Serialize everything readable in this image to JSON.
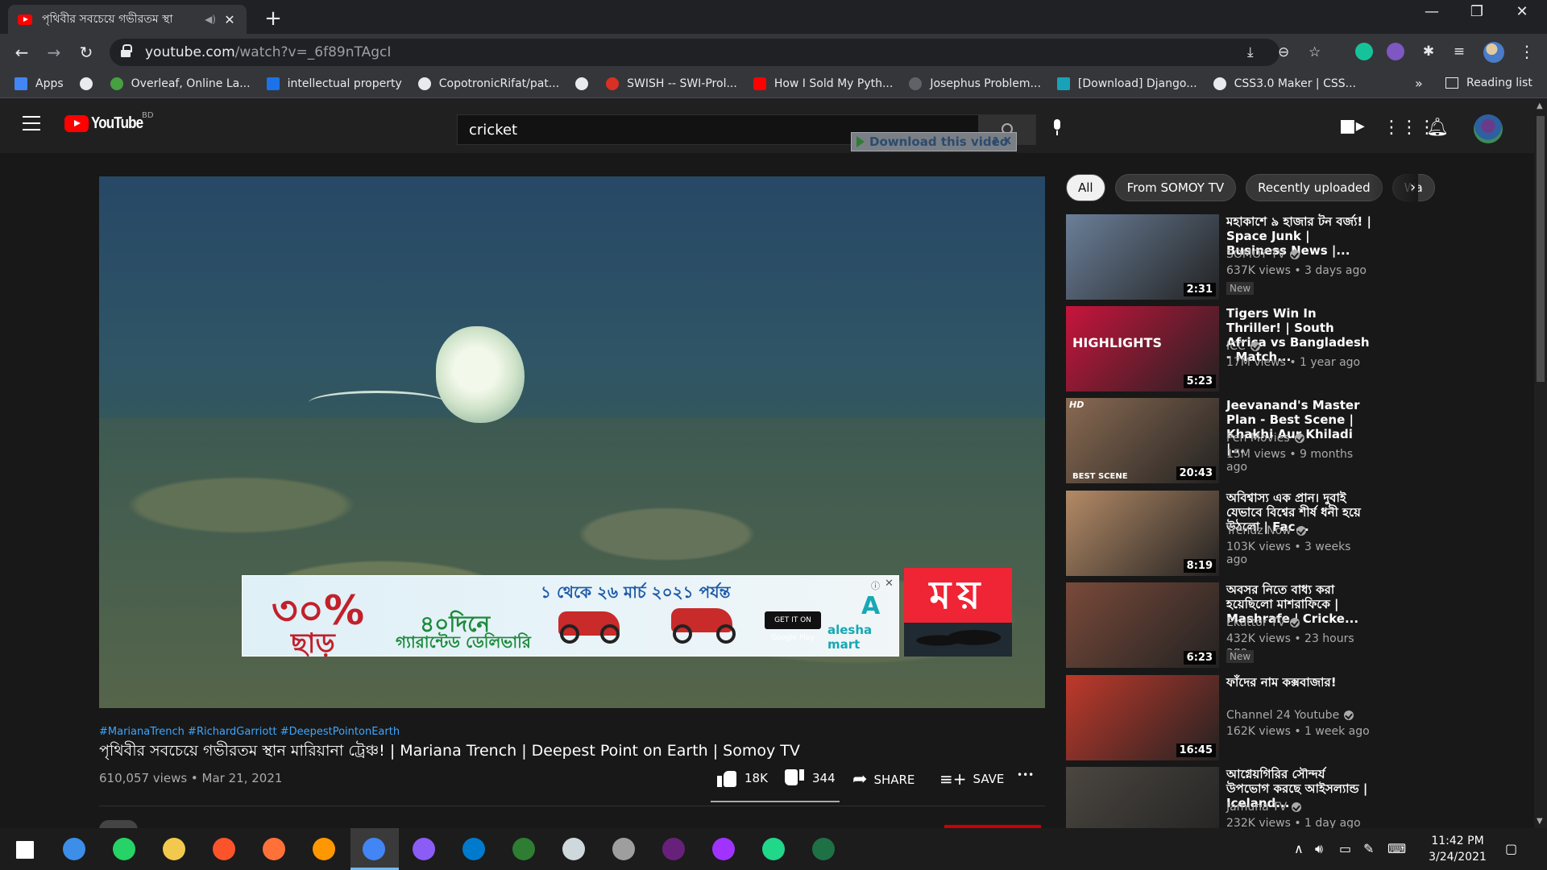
{
  "browser": {
    "tab_title": "পৃথিবীর সবচেয়ে গভীরতম স্থা",
    "url_host": "youtube.com",
    "url_path": "/watch?v=_6f89nTAgcI",
    "window_controls": [
      "—",
      "❐",
      "✕"
    ]
  },
  "bookmarks": [
    {
      "label": "Apps",
      "color": "#4285f4"
    },
    {
      "label": "",
      "color": "#e8eaed"
    },
    {
      "label": "Overleaf, Online La...",
      "color": "#47a141"
    },
    {
      "label": "intellectual property",
      "color": "#1a73e8"
    },
    {
      "label": "CopotronicRifat/pat...",
      "color": "#e8eaed"
    },
    {
      "label": "",
      "color": "#e8eaed"
    },
    {
      "label": "SWISH -- SWI-Prol...",
      "color": "#d93025"
    },
    {
      "label": "How I Sold My Pyth...",
      "color": "#ff0000"
    },
    {
      "label": "Josephus Problem...",
      "color": "#5f6368"
    },
    {
      "label": "[Download] Django...",
      "color": "#17a2b8"
    },
    {
      "label": "CSS3.0 Maker | CSS...",
      "color": "#e8eaed"
    }
  ],
  "bookmarks_more": "»",
  "reading_list": "Reading list",
  "youtube": {
    "logo_text": "YouTube",
    "country_code": "BD",
    "search_query": "cricket",
    "download_bar": "Download this video",
    "download_help": "?",
    "download_close": "X"
  },
  "ad": {
    "discount": "৩০%",
    "discount_word": "ছাড়",
    "date_range": "১ থেকে ২৬ মার্চ ২০২১ পর্যন্ত",
    "days_line": "৪০দিনে",
    "guarantee": "গ্যারান্টেড ডেলিভারি",
    "store_badge": "GET IT ON Google Play",
    "brand": "alesha mart",
    "brand_mark": "A",
    "info": "ⓘ",
    "close": "✕"
  },
  "channel_logo": "ময়",
  "video": {
    "hashtags": "#MarianaTrench #RichardGarriott #DeepestPointonEarth",
    "title": "পৃথিবীর সবচেয়ে গভীরতম স্থান মারিয়ানা ট্রেঞ্চ! | Mariana Trench | Deepest Point on Earth | Somoy TV",
    "meta": "610,057 views • Mar 21, 2021",
    "likes": "18K",
    "dislikes": "344",
    "like_ratio": 0.98,
    "share_label": "SHARE",
    "save_label": "SAVE",
    "more": "•••"
  },
  "chips": [
    "All",
    "From SOMOY TV",
    "Recently uploaded",
    "Wa"
  ],
  "recommendations": [
    {
      "title": "মহাকাশে ৯ হাজার টন বর্জ্য! | Space Junk | Business News |...",
      "channel": "SOMOY TV",
      "views": "637K views • 3 days ago",
      "duration": "2:31",
      "badge": "New",
      "thumb_bg": "#6b7f99"
    },
    {
      "title": "Tigers Win In Thriller! | South Africa vs Bangladesh - Match...",
      "channel": "ICC",
      "views": "17M views • 1 year ago",
      "duration": "5:23",
      "badge": "",
      "thumb_bg": "#c8143c",
      "thumb_text": "HIGHLIGHTS"
    },
    {
      "title": "Jeevanand's Master Plan - Best Scene | Khakhi Aur Khiladi |...",
      "channel": "Pen Movies",
      "views": "15M views • 9 months ago",
      "duration": "20:43",
      "badge": "",
      "thumb_bg": "#8a6a52",
      "thumb_text": "BEST SCENE",
      "thumb_hd": "HD"
    },
    {
      "title": "অবিশ্বাস্য এক প্রান। দুবাই যেভাবে বিশ্বের শীর্ষ ধনী হয়ে উঠলো | Fac...",
      "channel": "Trendz Now",
      "views": "103K views • 3 weeks ago",
      "duration": "8:19",
      "badge": "",
      "thumb_bg": "#b48a66"
    },
    {
      "title": "অবসর নিতে বাধ্য করা হয়েছিলো মাশরাফিকে | Mashrafe | Cricke...",
      "channel": "Ekattor TV",
      "views": "432K views • 23 hours ago",
      "duration": "6:23",
      "badge": "New",
      "thumb_bg": "#7a4a3a"
    },
    {
      "title": "ফাঁদের নাম কক্সবাজার!",
      "channel": "Channel 24 Youtube",
      "views": "162K views • 1 week ago",
      "duration": "16:45",
      "badge": "",
      "thumb_bg": "#c0392b"
    },
    {
      "title": "আগ্নেয়গিরির সৌন্দর্য উপভোগ করছে আইসল্যান্ড | Iceland...",
      "channel": "Jamuna TV",
      "views": "232K views • 1 day ago",
      "duration": "",
      "badge": "",
      "thumb_bg": "#4b4640"
    }
  ],
  "taskbar": {
    "time": "11:42 PM",
    "date": "3/24/2021",
    "icons": [
      "windows-start-icon",
      "refresh-app-icon",
      "whatsapp-icon",
      "file-explorer-icon",
      "brave-icon",
      "firefox-icon",
      "sublime-icon",
      "chrome-icon",
      "github-desktop-icon",
      "vscode-icon",
      "globe-app-icon",
      "paint-icon",
      "inkscape-icon",
      "visual-studio-icon",
      "messenger-icon",
      "pycharm-icon",
      "spreadsheet-icon"
    ],
    "icon_colors": [
      "#ffffff",
      "#3c8ee8",
      "#25d366",
      "#f2c94c",
      "#fb542b",
      "#ff7139",
      "#ff9800",
      "#4285f4",
      "#8b5cf6",
      "#007acc",
      "#2e7d32",
      "#cfd8dc",
      "#9e9e9e",
      "#68217a",
      "#a033ff",
      "#21d789",
      "#1e7145"
    ]
  }
}
